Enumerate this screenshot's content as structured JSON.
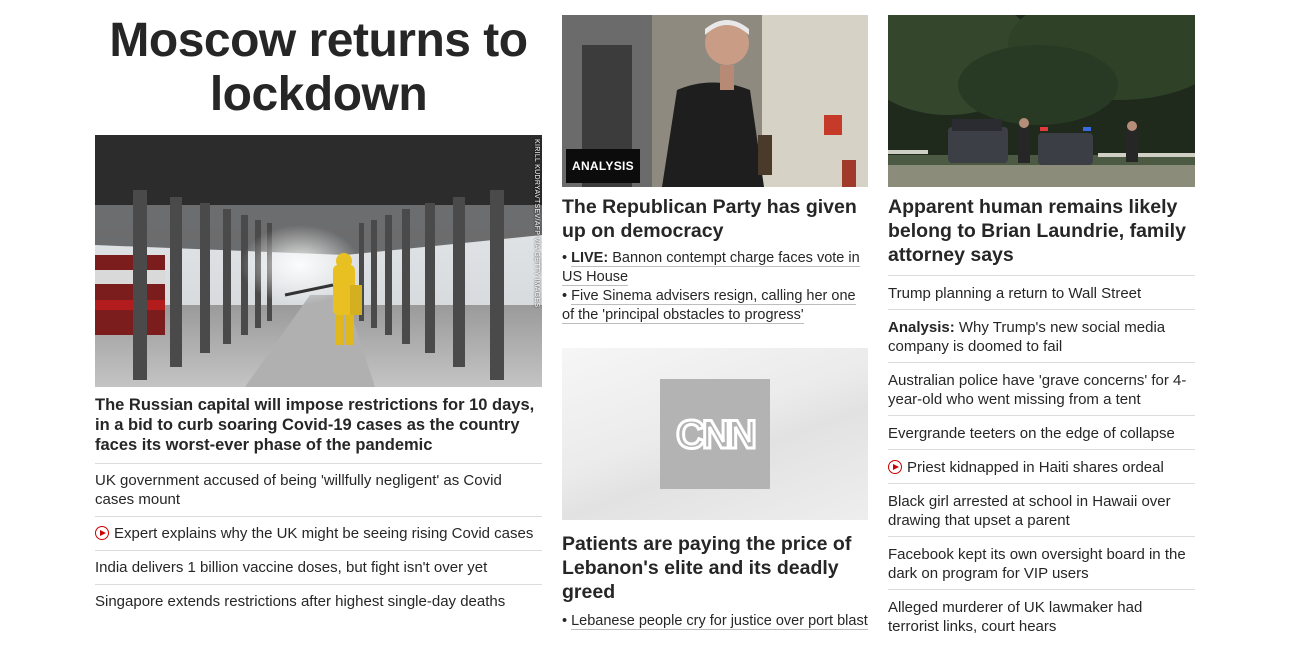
{
  "lead_story": {
    "headline": "Moscow returns to lockdown",
    "image_credit": "KIRILL KUDRYAVTSEV/AFP VIA GETTY IMAGES",
    "summary": "The Russian capital will impose restrictions for 10 days, in a bid to curb soaring Covid-19 cases as the country faces its worst-ever phase of the pandemic",
    "related": [
      {
        "text": "UK government accused of being 'willfully negligent' as Covid cases mount",
        "video": false
      },
      {
        "text": "Expert explains why the UK might be seeing rising Covid cases",
        "video": true
      },
      {
        "text": "India delivers 1 billion vaccine doses, but fight isn't over yet",
        "video": false
      },
      {
        "text": "Singapore extends restrictions after highest single-day deaths",
        "video": false
      }
    ]
  },
  "bannon_story": {
    "badge": "ANALYSIS",
    "headline": "The Republican Party has given up on democracy",
    "related": [
      {
        "prefix": "LIVE:",
        "text": "Bannon contempt charge faces vote in US House"
      },
      {
        "prefix": "",
        "text": "Five Sinema advisers resign, calling her one of the 'principal obstacles to progress'"
      }
    ]
  },
  "lebanon_story": {
    "logo_text": "CNN",
    "headline": "Patients are paying the price of Lebanon's elite and its deadly greed",
    "related": [
      {
        "prefix": "",
        "text": "Lebanese people cry for justice over port blast"
      }
    ]
  },
  "laundrie_story": {
    "headline": "Apparent human remains likely belong to Brian Laundrie, family attorney says",
    "related": [
      {
        "prefix": "",
        "text": "Trump planning a return to Wall Street",
        "video": false
      },
      {
        "prefix": "Analysis:",
        "text": "Why Trump's new social media company is doomed to fail",
        "video": false
      },
      {
        "prefix": "",
        "text": "Australian police have 'grave concerns' for 4-year-old who went missing from a tent",
        "video": false
      },
      {
        "prefix": "",
        "text": "Evergrande teeters on the edge of collapse",
        "video": false
      },
      {
        "prefix": "",
        "text": "Priest kidnapped in Haiti shares ordeal",
        "video": true
      },
      {
        "prefix": "",
        "text": "Black girl arrested at school in Hawaii over drawing that upset a parent",
        "video": false
      },
      {
        "prefix": "",
        "text": "Facebook kept its own oversight board in the dark on program for VIP users",
        "video": false
      },
      {
        "prefix": "",
        "text": "Alleged murderer of UK lawmaker had terrorist links, court hears",
        "video": false
      }
    ]
  },
  "colors": {
    "text": "#262626",
    "video_icon": "#cc0000",
    "badge_bg": "#0c0c0c",
    "divider": "#dcdcdc"
  }
}
